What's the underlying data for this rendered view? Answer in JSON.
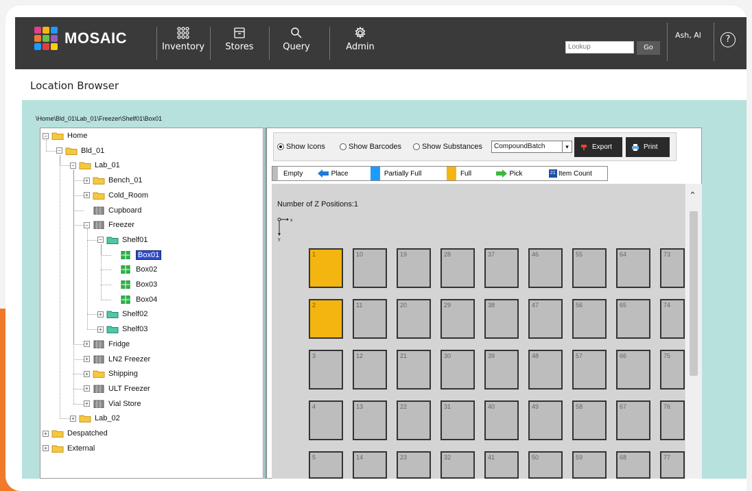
{
  "app": {
    "logo_text": "MOSAIC",
    "nav": [
      {
        "label": "Inventory",
        "icon": "grid-icon"
      },
      {
        "label": "Stores",
        "icon": "archive-box-icon"
      },
      {
        "label": "Query",
        "icon": "search-icon"
      },
      {
        "label": "Admin",
        "icon": "gear-icon"
      }
    ],
    "lookup_placeholder": "Lookup",
    "go_label": "Go",
    "user_name": "Ash, Al",
    "help_label": "?"
  },
  "page": {
    "title": "Location Browser",
    "breadcrumb": "\\Home\\Bld_01\\Lab_01\\Freezer\\Shelf01\\Box01"
  },
  "tree": [
    {
      "label": "Home",
      "level": 0,
      "exp": "−",
      "icon": "folder-icon"
    },
    {
      "label": "Bld_01",
      "level": 1,
      "exp": "−",
      "icon": "folder-icon"
    },
    {
      "label": "Lab_01",
      "level": 2,
      "exp": "−",
      "icon": "folder-icon"
    },
    {
      "label": "Bench_01",
      "level": 3,
      "exp": "+",
      "icon": "folder-icon"
    },
    {
      "label": "Cold_Room",
      "level": 3,
      "exp": "+",
      "icon": "folder-icon"
    },
    {
      "label": "Cupboard",
      "level": 3,
      "exp": "",
      "icon": "cabinet-icon"
    },
    {
      "label": "Freezer",
      "level": 3,
      "exp": "−",
      "icon": "cabinet-icon"
    },
    {
      "label": "Shelf01",
      "level": 4,
      "exp": "−",
      "icon": "shelf-icon"
    },
    {
      "label": "Box01",
      "level": 5,
      "exp": "",
      "icon": "box-icon",
      "selected": true
    },
    {
      "label": "Box02",
      "level": 5,
      "exp": "",
      "icon": "box-icon"
    },
    {
      "label": "Box03",
      "level": 5,
      "exp": "",
      "icon": "box-icon"
    },
    {
      "label": "Box04",
      "level": 5,
      "exp": "",
      "icon": "box-icon"
    },
    {
      "label": "Shelf02",
      "level": 4,
      "exp": "+",
      "icon": "shelf-icon"
    },
    {
      "label": "Shelf03",
      "level": 4,
      "exp": "+",
      "icon": "shelf-icon"
    },
    {
      "label": "Fridge",
      "level": 3,
      "exp": "+",
      "icon": "cabinet-icon"
    },
    {
      "label": "LN2 Freezer",
      "level": 3,
      "exp": "+",
      "icon": "cabinet-icon"
    },
    {
      "label": "Shipping",
      "level": 3,
      "exp": "+",
      "icon": "folder-icon"
    },
    {
      "label": "ULT Freezer",
      "level": 3,
      "exp": "+",
      "icon": "cabinet-icon"
    },
    {
      "label": "Vial Store",
      "level": 3,
      "exp": "+",
      "icon": "cabinet-icon"
    },
    {
      "label": "Lab_02",
      "level": 2,
      "exp": "+",
      "icon": "folder-icon"
    },
    {
      "label": "Despatched",
      "level": 0,
      "exp": "+",
      "icon": "folder-icon"
    },
    {
      "label": "External",
      "level": 0,
      "exp": "+",
      "icon": "folder-icon"
    }
  ],
  "toolbar": {
    "radio_icons": "Show Icons",
    "radio_barcodes": "Show Barcodes",
    "radio_substances": "Show Substances",
    "selected_radio": "icons",
    "select_value": "CompoundBatch",
    "export_label": "Export",
    "print_label": "Print"
  },
  "legend": [
    {
      "label": "Empty",
      "color": "#bdbdbd",
      "icon": ""
    },
    {
      "label": "Place",
      "color": "#ffffff",
      "icon": "arrow-left-icon"
    },
    {
      "label": "Partially Full",
      "color": "#1e9bff",
      "icon": ""
    },
    {
      "label": "Full",
      "color": "#f5b510",
      "icon": ""
    },
    {
      "label": "Pick",
      "color": "#ffffff",
      "icon": "arrow-right-icon"
    },
    {
      "label": "Item Count",
      "color": "#ffffff",
      "icon": "count-icon"
    }
  ],
  "grid": {
    "z_positions_label": "Number of Z Positions:1",
    "axis_x": "x",
    "axis_y": "y",
    "rows": 9,
    "columns": [
      1,
      10,
      19,
      28,
      37,
      46,
      55,
      64,
      73
    ],
    "full_cells": [
      1,
      2
    ],
    "visible_rows": 5
  }
}
